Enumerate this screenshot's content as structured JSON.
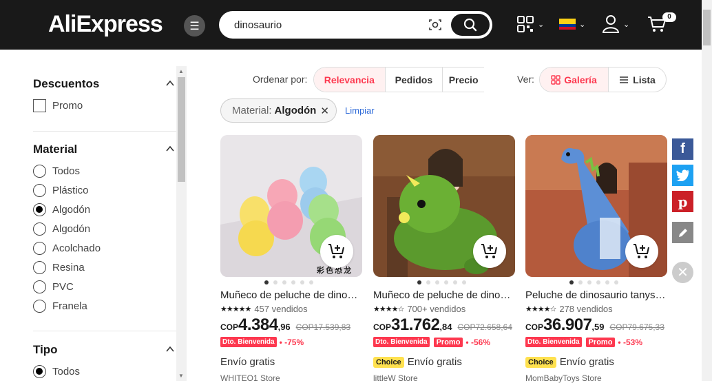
{
  "header": {
    "logo": "AliExpress",
    "search_value": "dinosaurio",
    "cart_count": "0",
    "icons": [
      "menu-icon",
      "camera-search-icon",
      "search-icon",
      "qr-code-icon",
      "colombia-flag-icon",
      "user-icon",
      "cart-icon"
    ]
  },
  "sidebar": {
    "discounts": {
      "title": "Descuentos",
      "options": [
        "Promo"
      ]
    },
    "material": {
      "title": "Material",
      "options": [
        "Todos",
        "Plástico",
        "Algodón",
        "Algodón",
        "Acolchado",
        "Resina",
        "PVC",
        "Franela"
      ],
      "selected_index": 2
    },
    "tipo": {
      "title": "Tipo",
      "options": [
        "Todos"
      ],
      "selected_index": 0
    }
  },
  "sort": {
    "label": "Ordenar por:",
    "tabs": [
      "Relevancia",
      "Pedidos",
      "Precio"
    ],
    "active": "Relevancia"
  },
  "view": {
    "label": "Ver:",
    "tabs": [
      "Galería",
      "Lista"
    ],
    "active": "Galería"
  },
  "filter_chip": {
    "key": "Material:",
    "value": "Algodón"
  },
  "clear_label": "Limpiar",
  "products": [
    {
      "title": "Muñeco de peluche de dinosaurio",
      "sold": "457 vendidos",
      "rating_stars": 5,
      "currency": "COP",
      "price_int": "4.384",
      "price_dec": ",96",
      "old_price": "COP17.539,83",
      "tag": "Dto. Bienvenida",
      "promo_tag": "",
      "discount": "-75%",
      "choice": "",
      "shipping": "Envío gratis",
      "store": "WHITEO1 Store",
      "image_text": "彩色恐龙"
    },
    {
      "title": "Muñeco de peluche de dinosaurio",
      "sold": "700+ vendidos",
      "rating_stars": 4.5,
      "currency": "COP",
      "price_int": "31.762",
      "price_dec": ",84",
      "old_price": "COP72.658,64",
      "tag": "Dto. Bienvenida",
      "promo_tag": "Promo",
      "discount": "-56%",
      "choice": "Choice",
      "shipping": "Envío gratis",
      "store": "littleW Store"
    },
    {
      "title": "Peluche de dinosaurio tanystropheus",
      "sold": "278 vendidos",
      "rating_stars": 4.5,
      "currency": "COP",
      "price_int": "36.907",
      "price_dec": ",59",
      "old_price": "COP79.675,33",
      "tag": "Dto. Bienvenida",
      "promo_tag": "Promo",
      "discount": "-53%",
      "choice": "Choice",
      "shipping": "Envío gratis",
      "store": "MomBabyToys Store"
    }
  ],
  "social": [
    "facebook-icon",
    "twitter-icon",
    "pinterest-icon",
    "edit-icon",
    "close-icon"
  ],
  "colors": {
    "accent": "#fd384f",
    "header_bg": "#191919",
    "choice": "#ffe14f"
  }
}
